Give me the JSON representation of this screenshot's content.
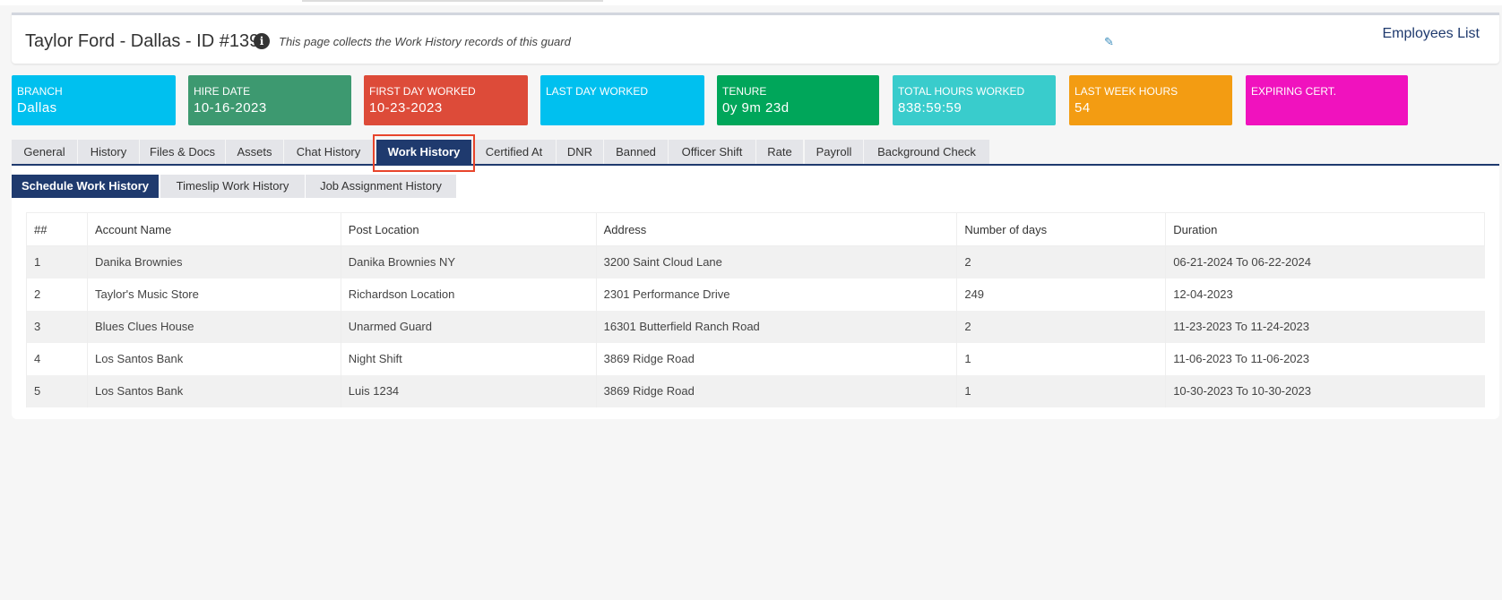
{
  "header": {
    "title": "Taylor Ford - Dallas - ID #139",
    "subtitle": "This page collects the Work History records of this guard",
    "employees_link": "Employees List"
  },
  "stats": [
    {
      "label": "BRANCH",
      "value": "Dallas",
      "color": "#00c0ef"
    },
    {
      "label": "HIRE DATE",
      "value": "10-16-2023",
      "color": "#3d9970"
    },
    {
      "label": "FIRST DAY WORKED",
      "value": "10-23-2023",
      "color": "#dd4b39"
    },
    {
      "label": "LAST DAY WORKED",
      "value": "",
      "color": "#00c0ef"
    },
    {
      "label": "TENURE",
      "value": "0y 9m 23d",
      "color": "#00a65a"
    },
    {
      "label": "TOTAL HOURS WORKED",
      "value": "838:59:59",
      "color": "#39cccc"
    },
    {
      "label": "LAST WEEK HOURS",
      "value": "54",
      "color": "#f39c12"
    },
    {
      "label": "EXPIRING CERT.",
      "value": "",
      "color": "#f012be"
    }
  ],
  "tabs": [
    "General",
    "History",
    "Files & Docs",
    "Assets",
    "Chat History",
    "Work History",
    "Certified At",
    "DNR",
    "Banned",
    "Officer Shift",
    "Rate",
    "Payroll",
    "Background Check"
  ],
  "active_tab": "Work History",
  "subtabs": [
    "Schedule Work History",
    "Timeslip Work History",
    "Job Assignment History"
  ],
  "table": {
    "headers": [
      "##",
      "Account Name",
      "Post Location",
      "Address",
      "Number of days",
      "Duration"
    ],
    "rows": [
      [
        "1",
        "Danika Brownies",
        "Danika Brownies NY",
        "3200 Saint Cloud Lane",
        "2",
        "06-21-2024 To 06-22-2024"
      ],
      [
        "2",
        "Taylor's Music Store",
        "Richardson Location",
        "2301 Performance Drive",
        "249",
        "12-04-2023"
      ],
      [
        "3",
        "Blues Clues House",
        "Unarmed Guard",
        "16301 Butterfield Ranch Road",
        "2",
        "11-23-2023 To 11-24-2023"
      ],
      [
        "4",
        "Los Santos Bank",
        "Night Shift",
        "3869 Ridge Road",
        "1",
        "11-06-2023 To 11-06-2023"
      ],
      [
        "5",
        "Los Santos Bank",
        "Luis 1234",
        "3869 Ridge Road",
        "1",
        "10-30-2023 To 10-30-2023"
      ]
    ]
  }
}
